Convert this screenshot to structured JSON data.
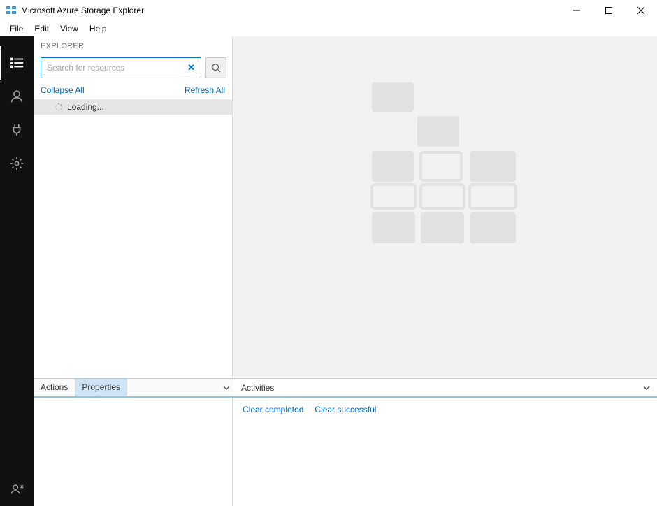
{
  "window": {
    "title": "Microsoft Azure Storage Explorer"
  },
  "menubar": [
    "File",
    "Edit",
    "View",
    "Help"
  ],
  "explorer": {
    "header": "EXPLORER",
    "search_placeholder": "Search for resources",
    "collapse_label": "Collapse All",
    "refresh_label": "Refresh All",
    "tree_loading_label": "Loading..."
  },
  "left_tabs": {
    "actions": "Actions",
    "properties": "Properties",
    "active": "properties"
  },
  "activities": {
    "label": "Activities",
    "clear_completed": "Clear completed",
    "clear_successful": "Clear successful"
  }
}
